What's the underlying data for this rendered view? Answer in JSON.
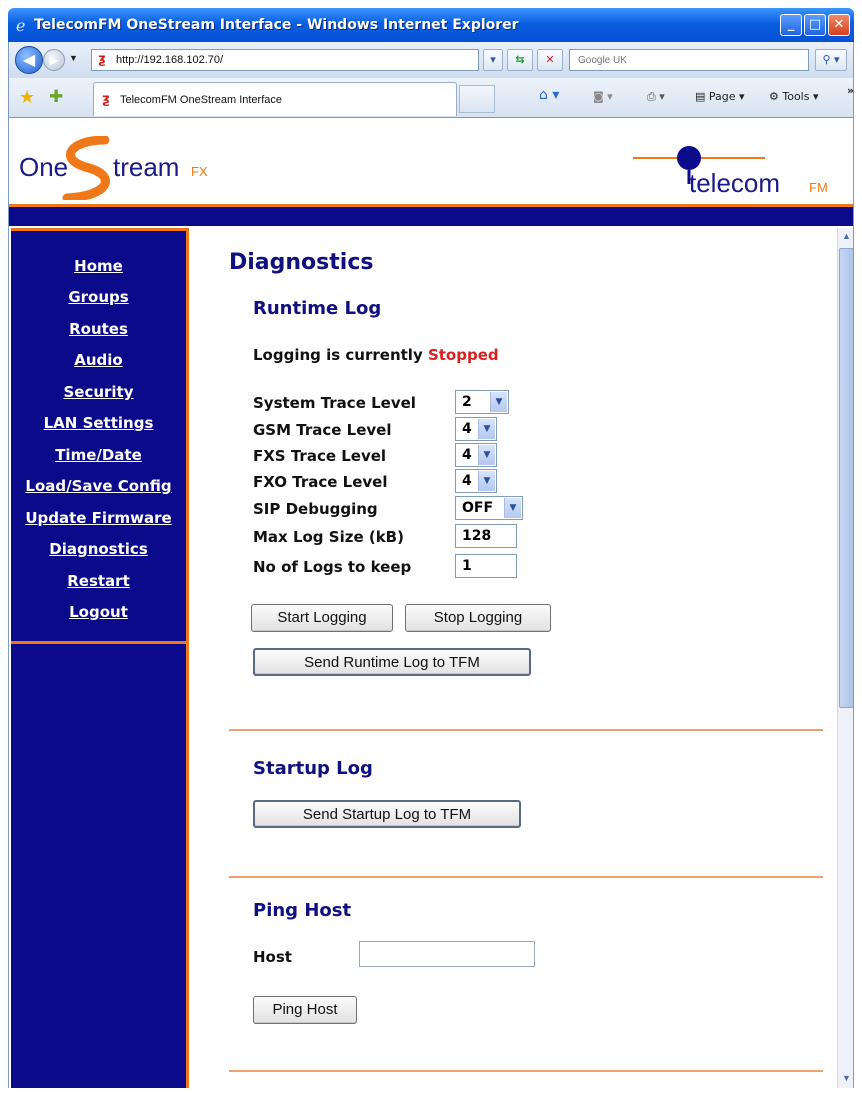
{
  "browser": {
    "window_title": "TelecomFM OneStream Interface - Windows Internet Explorer",
    "url": "http://192.168.102.70/",
    "search_placeholder": "Google UK",
    "tab_title": "TelecomFM OneStream Interface",
    "page_menu": "Page",
    "tools_menu": "Tools"
  },
  "header": {
    "logo_left_1": "One",
    "logo_left_2": "tream",
    "logo_left_fx": "FX",
    "logo_right": "telecom",
    "logo_right_fm": "FM",
    "brand_orange": "#f07818",
    "brand_navy": "#0a0a8a"
  },
  "sidebar": {
    "items": [
      {
        "label": "Home"
      },
      {
        "label": "Groups"
      },
      {
        "label": "Routes"
      },
      {
        "label": "Audio"
      },
      {
        "label": "Security"
      },
      {
        "label": "LAN Settings"
      },
      {
        "label": "Time/Date"
      },
      {
        "label": "Load/Save Config"
      },
      {
        "label": "Update Firmware"
      },
      {
        "label": "Diagnostics"
      },
      {
        "label": "Restart"
      },
      {
        "label": "Logout"
      }
    ]
  },
  "main": {
    "page_title": "Diagnostics",
    "runtime": {
      "heading": "Runtime Log",
      "status_prefix": "Logging is currently",
      "status_value": "Stopped",
      "fields": {
        "system_trace_label": "System Trace Level",
        "system_trace_value": "2",
        "gsm_trace_label": "GSM Trace Level",
        "gsm_trace_value": "4",
        "fxs_trace_label": "FXS Trace Level",
        "fxs_trace_value": "4",
        "fxo_trace_label": "FXO Trace Level",
        "fxo_trace_value": "4",
        "sip_debug_label": "SIP Debugging",
        "sip_debug_value": "OFF",
        "max_log_label": "Max Log Size (kB)",
        "max_log_value": "128",
        "logs_keep_label": "No of Logs to keep",
        "logs_keep_value": "1"
      },
      "start_button": "Start Logging",
      "stop_button": "Stop Logging",
      "send_button": "Send Runtime Log to TFM"
    },
    "startup": {
      "heading": "Startup Log",
      "send_button": "Send Startup Log to TFM"
    },
    "ping": {
      "heading": "Ping Host",
      "host_label": "Host",
      "host_value": "",
      "button": "Ping Host"
    }
  }
}
